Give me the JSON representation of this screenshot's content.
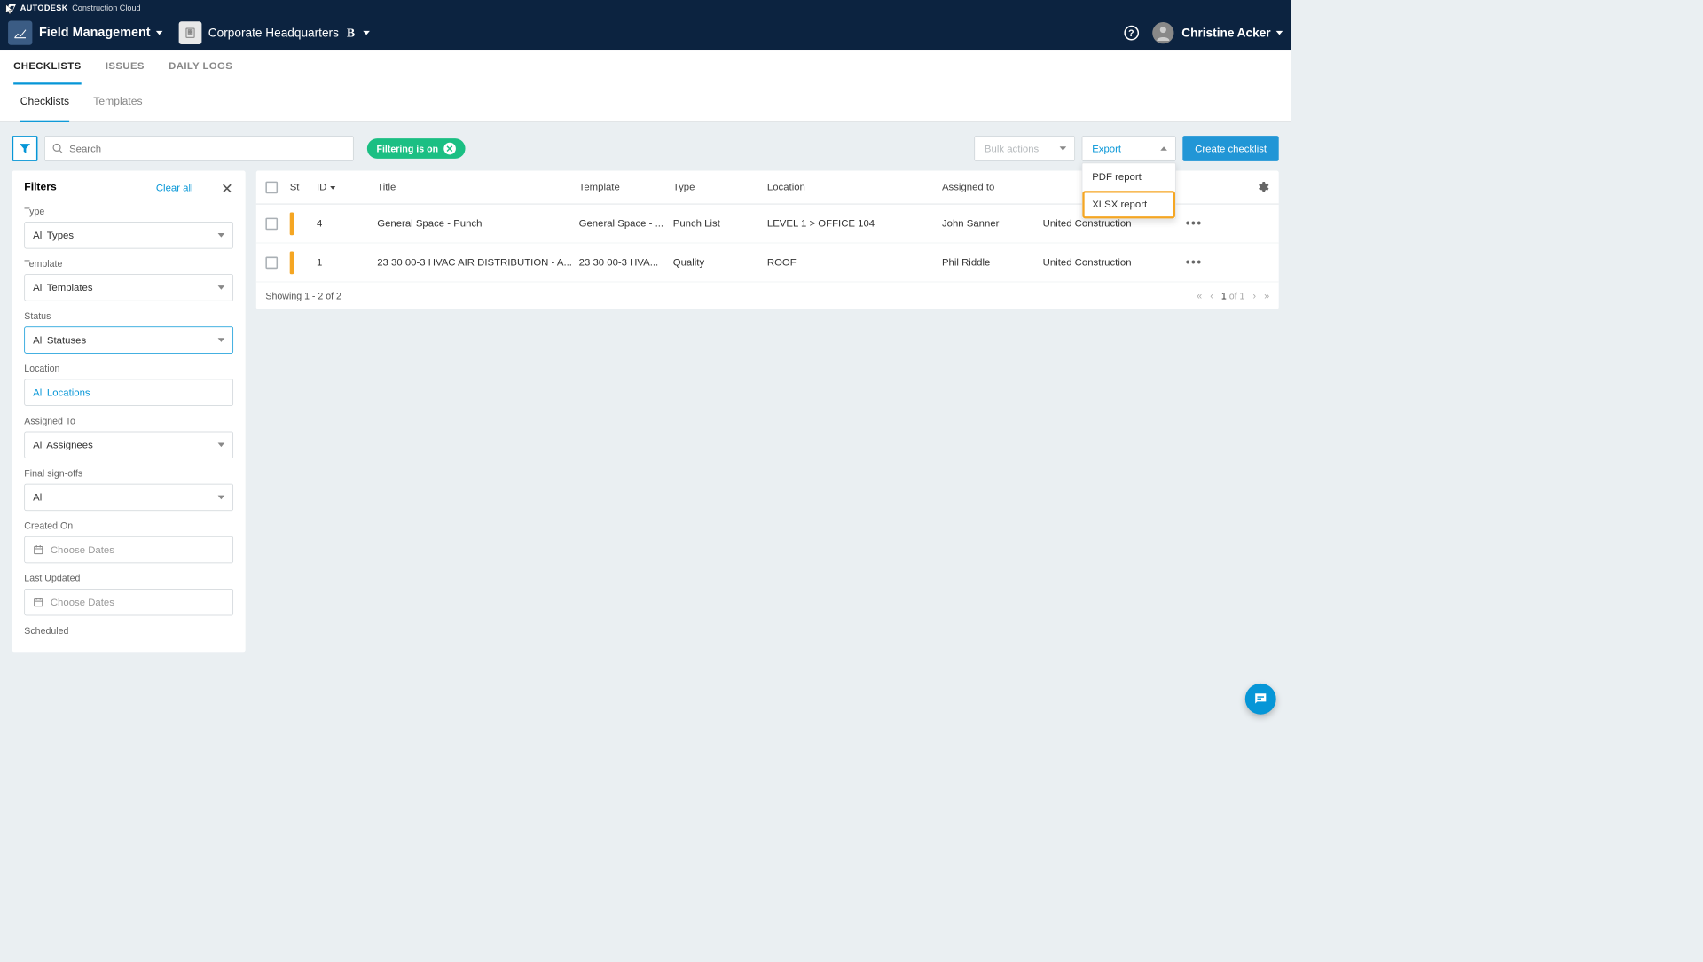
{
  "brand": {
    "vendor": "AUTODESK",
    "product": "Construction Cloud"
  },
  "header": {
    "app_name": "Field Management",
    "project_name": "Corporate Headquarters",
    "project_badge": "B",
    "user_name": "Christine Acker"
  },
  "main_tabs": [
    {
      "label": "CHECKLISTS",
      "active": true
    },
    {
      "label": "ISSUES",
      "active": false
    },
    {
      "label": "DAILY LOGS",
      "active": false
    }
  ],
  "sub_tabs": [
    {
      "label": "Checklists",
      "active": true
    },
    {
      "label": "Templates",
      "active": false
    }
  ],
  "toolbar": {
    "search_placeholder": "Search",
    "filtering_chip": "Filtering is on",
    "bulk_actions_label": "Bulk actions",
    "export_label": "Export",
    "export_menu": {
      "pdf": "PDF report",
      "xlsx": "XLSX report"
    },
    "create_label": "Create checklist"
  },
  "filters": {
    "title": "Filters",
    "clear_all": "Clear all",
    "groups": {
      "type": {
        "label": "Type",
        "value": "All Types"
      },
      "template": {
        "label": "Template",
        "value": "All Templates"
      },
      "status": {
        "label": "Status",
        "value": "All Statuses"
      },
      "location": {
        "label": "Location",
        "value": "All Locations"
      },
      "assigned_to": {
        "label": "Assigned To",
        "value": "All Assignees"
      },
      "final_signoffs": {
        "label": "Final sign-offs",
        "value": "All"
      },
      "created_on": {
        "label": "Created On",
        "placeholder": "Choose Dates"
      },
      "last_updated": {
        "label": "Last Updated",
        "placeholder": "Choose Dates"
      },
      "scheduled": {
        "label": "Scheduled"
      }
    }
  },
  "grid": {
    "columns": {
      "st": "St",
      "id": "ID",
      "title": "Title",
      "template": "Template",
      "type": "Type",
      "location": "Location",
      "assigned_to": "Assigned to"
    },
    "rows": [
      {
        "id": "4",
        "title": "General Space - Punch",
        "template": "General Space - ...",
        "type": "Punch List",
        "location": "LEVEL 1 > OFFICE 104",
        "assigned_to": "John Sanner",
        "company": "United Construction"
      },
      {
        "id": "1",
        "title": "23 30 00-3 HVAC AIR DISTRIBUTION - A...",
        "template": "23 30 00-3 HVA...",
        "type": "Quality",
        "location": "ROOF",
        "assigned_to": "Phil Riddle",
        "company": "United Construction"
      }
    ],
    "footer": {
      "showing": "Showing 1 - 2 of 2",
      "page_current": "1",
      "page_of": "of",
      "page_total": "1"
    }
  }
}
